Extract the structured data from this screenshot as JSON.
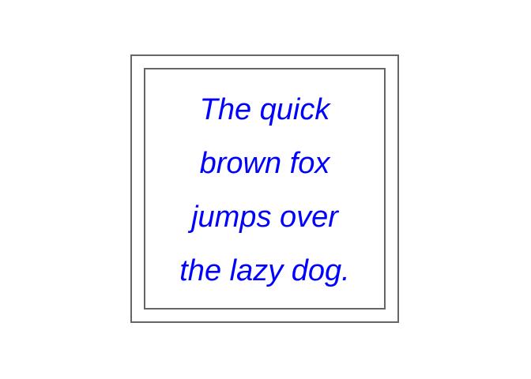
{
  "text_block": {
    "lines": [
      "The quick",
      "brown fox",
      "jumps over",
      "the lazy dog."
    ],
    "color": "#0000ff"
  },
  "frame": {
    "border_color": "#666666"
  }
}
